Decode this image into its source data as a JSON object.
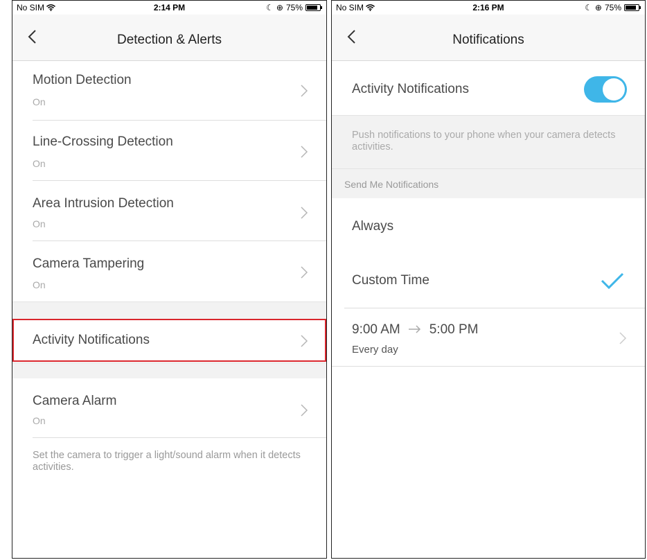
{
  "left": {
    "status": {
      "carrier": "No SIM",
      "time": "2:14 PM",
      "battery": "75%"
    },
    "nav": {
      "title": "Detection & Alerts"
    },
    "items": [
      {
        "title": "Motion Detection",
        "value": "On"
      },
      {
        "title": "Line-Crossing Detection",
        "value": "On"
      },
      {
        "title": "Area Intrusion Detection",
        "value": "On"
      },
      {
        "title": "Camera Tampering",
        "value": "On"
      }
    ],
    "activity": {
      "title": "Activity Notifications"
    },
    "alarm": {
      "title": "Camera Alarm",
      "value": "On"
    },
    "alarm_note": "Set the camera to trigger a light/sound alarm when it detects activities."
  },
  "right": {
    "status": {
      "carrier": "No SIM",
      "time": "2:16 PM",
      "battery": "75%"
    },
    "nav": {
      "title": "Notifications"
    },
    "activity_toggle": {
      "label": "Activity Notifications",
      "state": "on"
    },
    "description": "Push notifications to your phone when your camera detects activities.",
    "section_header": "Send Me Notifications",
    "options": [
      {
        "label": "Always",
        "selected": false
      },
      {
        "label": "Custom Time",
        "selected": true
      }
    ],
    "schedule": {
      "start": "9:00 AM",
      "end": "5:00 PM",
      "repeat": "Every day"
    }
  },
  "colors": {
    "accent": "#3fb6e8",
    "highlight_border": "#d9252c"
  }
}
